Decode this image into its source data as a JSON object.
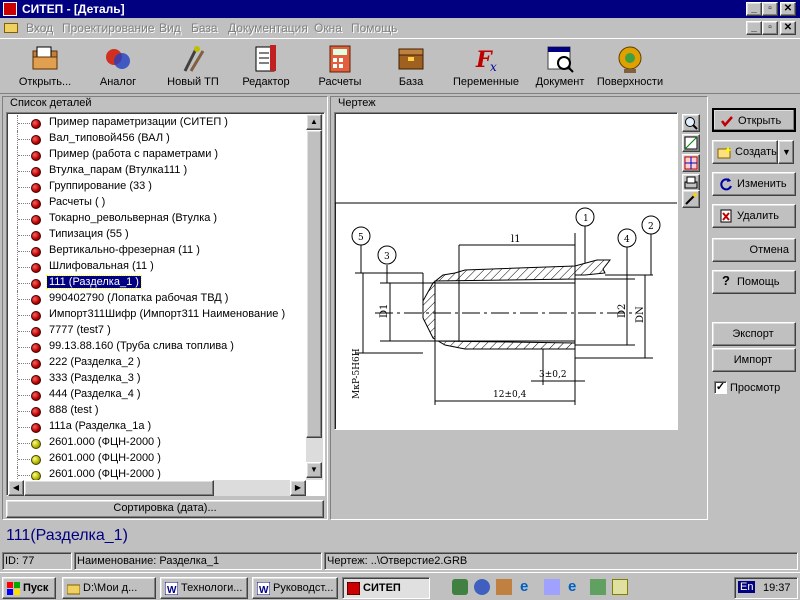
{
  "window": {
    "title": "СИТЕП - [Деталь]"
  },
  "menu": [
    "Вход",
    "Проектирование",
    "Вид",
    "База",
    "Документация",
    "Окна",
    "Помощь"
  ],
  "toolbar": [
    {
      "label": "Открыть...",
      "icon": "open-icon"
    },
    {
      "label": "Аналог",
      "icon": "analog-icon"
    },
    {
      "label": "Новый ТП",
      "icon": "new-tp-icon"
    },
    {
      "label": "Редактор",
      "icon": "editor-icon"
    },
    {
      "label": "Расчеты",
      "icon": "calculator-icon"
    },
    {
      "label": "База",
      "icon": "database-icon"
    },
    {
      "label": "Переменные",
      "icon": "variables-icon"
    },
    {
      "label": "Документ",
      "icon": "document-icon"
    },
    {
      "label": "Поверхности",
      "icon": "surfaces-icon"
    }
  ],
  "parts_panel": {
    "title": "Список деталей",
    "sort_button": "Сортировка (дата)...",
    "items": [
      {
        "label": "Пример параметризации (СИТЕП )",
        "status": "red"
      },
      {
        "label": "Вал_типовой456 (ВАЛ )",
        "status": "red"
      },
      {
        "label": "Пример (работа с параметрами )",
        "status": "red"
      },
      {
        "label": "Втулка_парам (Втулка111 )",
        "status": "red"
      },
      {
        "label": "Группирование (33 )",
        "status": "red"
      },
      {
        "label": "Расчеты ( )",
        "status": "red"
      },
      {
        "label": "Токарно_револьверная (Втулка )",
        "status": "red"
      },
      {
        "label": "Типизация (55 )",
        "status": "red"
      },
      {
        "label": "Вертикально-фрезерная (11 )",
        "status": "red"
      },
      {
        "label": "Шлифовальная (11 )",
        "status": "red"
      },
      {
        "label": "111 (Разделка_1 )",
        "status": "red",
        "selected": true
      },
      {
        "label": "990402790 (Лопатка рабочая ТВД )",
        "status": "red"
      },
      {
        "label": "Импорт311Шифр (Импорт311 Наименование )",
        "status": "red"
      },
      {
        "label": "7777 (test7 )",
        "status": "red"
      },
      {
        "label": "99.13.88.160 (Труба слива топлива )",
        "status": "red"
      },
      {
        "label": "222 (Разделка_2 )",
        "status": "red"
      },
      {
        "label": "333 (Разделка_3 )",
        "status": "red"
      },
      {
        "label": "444 (Разделка_4 )",
        "status": "red"
      },
      {
        "label": "888 (test )",
        "status": "red"
      },
      {
        "label": "111a (Разделка_1a )",
        "status": "red"
      },
      {
        "label": "2601.000 (ФЦН-2000 )",
        "status": "yellow"
      },
      {
        "label": "2601.000 (ФЦН-2000 )",
        "status": "yellow"
      },
      {
        "label": "2601.000 (ФЦН-2000 )",
        "status": "yellow"
      }
    ]
  },
  "drawing_panel": {
    "title": "Чертеж",
    "labels": {
      "l1": "l1",
      "d1": "D1",
      "d2": "D2",
      "dn": "DN",
      "thread": "MкP-5H6H",
      "dim12": "12±0,4",
      "dim3": "3±0,2",
      "b1": "1",
      "b2": "2",
      "b3": "3",
      "b4": "4",
      "b5": "5"
    }
  },
  "actions": {
    "open": "Открыть",
    "create": "Создать",
    "edit": "Изменить",
    "delete": "Удалить",
    "cancel": "Отмена",
    "help": "Помощь",
    "export": "Экспорт",
    "import": "Импорт",
    "preview": "Просмотр",
    "preview_checked": true
  },
  "selected_title": "111(Разделка_1)",
  "status": {
    "id": "ID: 77",
    "name": "Наименование: Разделка_1",
    "drawing": "Чертеж: ..\\Отверстие2.GRB"
  },
  "taskbar": {
    "start": "Пуск",
    "tasks": [
      "D:\\Мои д...",
      "Технологи...",
      "Руководст...",
      "СИТЕП"
    ],
    "lang": "En",
    "time": "19:37"
  }
}
